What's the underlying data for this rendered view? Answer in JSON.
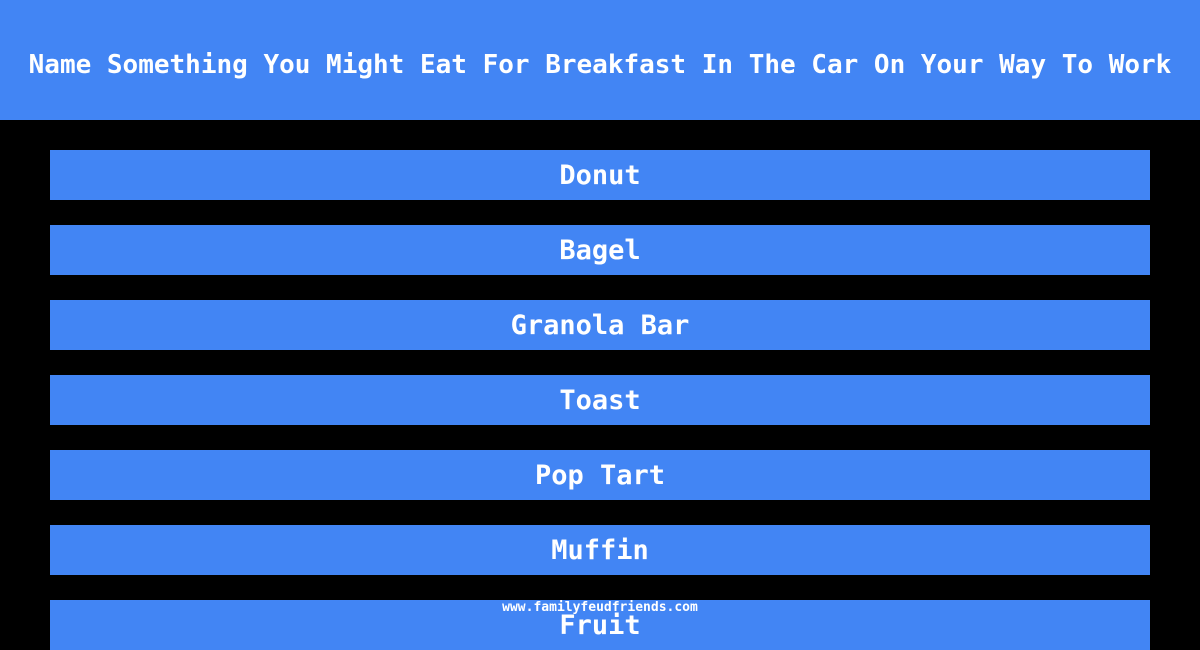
{
  "question": "Name Something You Might Eat For Breakfast In The Car On Your Way To Work",
  "answers": [
    "Donut",
    "Bagel",
    "Granola Bar",
    "Toast",
    "Pop Tart",
    "Muffin",
    "Fruit"
  ],
  "watermark": "www.familyfeudfriends.com",
  "colors": {
    "accent": "#4285f4",
    "background": "#000000",
    "text": "#ffffff"
  }
}
